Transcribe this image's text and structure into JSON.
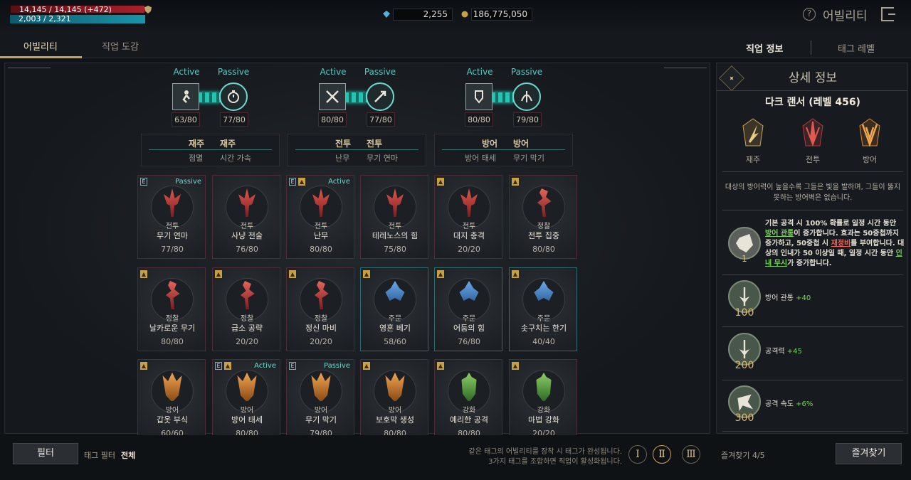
{
  "status": {
    "hp": "14,145 / 14,145 (+472)",
    "mp": "2,003 / 2,321"
  },
  "currency": {
    "gems": "2,255",
    "gold": "186,775,050"
  },
  "header": {
    "title": "어빌리티",
    "help": "?"
  },
  "tabs": [
    "어빌리티",
    "직업 도감"
  ],
  "right_tabs": [
    "직업 정보",
    "태그 레벨"
  ],
  "groups": [
    {
      "active_label": "Active",
      "passive_label": "Passive",
      "active_count": "63/80",
      "passive_count": "77/80",
      "tag_a": "재주",
      "tag_b": "재주",
      "sub_a": "점멸",
      "sub_b": "시간 가속"
    },
    {
      "active_label": "Active",
      "passive_label": "Passive",
      "active_count": "80/80",
      "passive_count": "77/80",
      "tag_a": "전투",
      "tag_b": "전투",
      "sub_a": "난무",
      "sub_b": "무기 연마"
    },
    {
      "active_label": "Active",
      "passive_label": "Passive",
      "active_count": "80/80",
      "passive_count": "79/80",
      "tag_a": "방어",
      "tag_b": "방어",
      "sub_a": "방어 태세",
      "sub_b": "무기 막기"
    }
  ],
  "cards": [
    [
      {
        "tag": "전투",
        "name": "무기 연마",
        "count": "77/80",
        "badge": "E",
        "mode": "Passive"
      },
      {
        "tag": "전투",
        "name": "사냥 전술",
        "count": "76/80",
        "badge": "",
        "mode": ""
      },
      {
        "tag": "전투",
        "name": "난무",
        "count": "80/80",
        "badge": "EU",
        "mode": "Active"
      },
      {
        "tag": "전투",
        "name": "테레노스의 힘",
        "count": "75/80",
        "badge": "",
        "mode": ""
      },
      {
        "tag": "전투",
        "name": "대지 충격",
        "count": "20/20",
        "badge": "U",
        "mode": ""
      },
      {
        "tag": "정찰",
        "name": "전투 집중",
        "count": "80/80",
        "badge": "U",
        "mode": ""
      }
    ],
    [
      {
        "tag": "정찰",
        "name": "날카로운 무기",
        "count": "80/80",
        "badge": "U",
        "mode": ""
      },
      {
        "tag": "정찰",
        "name": "급소 공략",
        "count": "20/20",
        "badge": "U",
        "mode": ""
      },
      {
        "tag": "정찰",
        "name": "정신 마비",
        "count": "20/20",
        "badge": "U",
        "mode": ""
      },
      {
        "tag": "주문",
        "name": "영혼 베기",
        "count": "58/60",
        "badge": "U",
        "mode": ""
      },
      {
        "tag": "주문",
        "name": "어둠의 힘",
        "count": "76/80",
        "badge": "U",
        "mode": ""
      },
      {
        "tag": "주문",
        "name": "솟구치는 한기",
        "count": "40/40",
        "badge": "U",
        "mode": ""
      }
    ],
    [
      {
        "tag": "방어",
        "name": "갑옷 부식",
        "count": "60/60",
        "badge": "U",
        "mode": ""
      },
      {
        "tag": "방어",
        "name": "방어 태세",
        "count": "80/80",
        "badge": "EU",
        "mode": "Active"
      },
      {
        "tag": "방어",
        "name": "무기 막기",
        "count": "79/80",
        "badge": "E",
        "mode": "Passive"
      },
      {
        "tag": "방어",
        "name": "보호막 생성",
        "count": "80/80",
        "badge": "U",
        "mode": ""
      },
      {
        "tag": "강화",
        "name": "예리한 공격",
        "count": "80/80",
        "badge": "U",
        "mode": ""
      },
      {
        "tag": "강화",
        "name": "마법 강화",
        "count": "20/20",
        "badge": "U",
        "mode": ""
      }
    ]
  ],
  "side": {
    "title": "상세 정보",
    "class_name": "다크 랜서 (레벨 456)",
    "class_tags": [
      "재주",
      "전투",
      "방어"
    ],
    "description": "대상의 방어력이 높을수록 그들은 빛을 발하며, 그들이 뚫지 못하는 방어벽은 없습니다.",
    "key_level": "1",
    "key_text": {
      "p1": "기본 공격 시 100% 확률로 일정 시간 동안 ",
      "g1": "방어 관통",
      "p2": "이 증가합니다. 효과는 50중첩까지 증가하고, 50중첩 시 ",
      "r1": "재정비",
      "p3": "를 부여합니다. 대상의 인내가 50 이상일 때, 일정 시간 동안 ",
      "g2": "인내 무시",
      "p4": "가 증가합니다."
    },
    "perks": [
      {
        "level": "100",
        "label": "방어 관통",
        "value": "+40"
      },
      {
        "level": "200",
        "label": "공격력",
        "value": "+45"
      },
      {
        "level": "300",
        "label": "공격 속도",
        "value": "+6%"
      }
    ]
  },
  "bottom": {
    "filter_btn": "필터",
    "tag_filter_label": "태그 필터",
    "tag_filter_value": "전체",
    "hint1": "같은 태그의 어빌리티를 장착 시 태그가 완성됩니다.",
    "hint2": "3가지 태그를 조합하면 직업이 활성화됩니다.",
    "preset_numerals": [
      "Ⅰ",
      "Ⅱ",
      "Ⅲ"
    ],
    "favorites_count": "즐겨찾기 4/5",
    "favorites_btn": "즐겨찾기"
  },
  "colors": {
    "accent_gold": "#c9a25a",
    "teal": "#6fd8cf",
    "hp_red": "#a8202b",
    "mp_teal": "#1a95a8"
  }
}
